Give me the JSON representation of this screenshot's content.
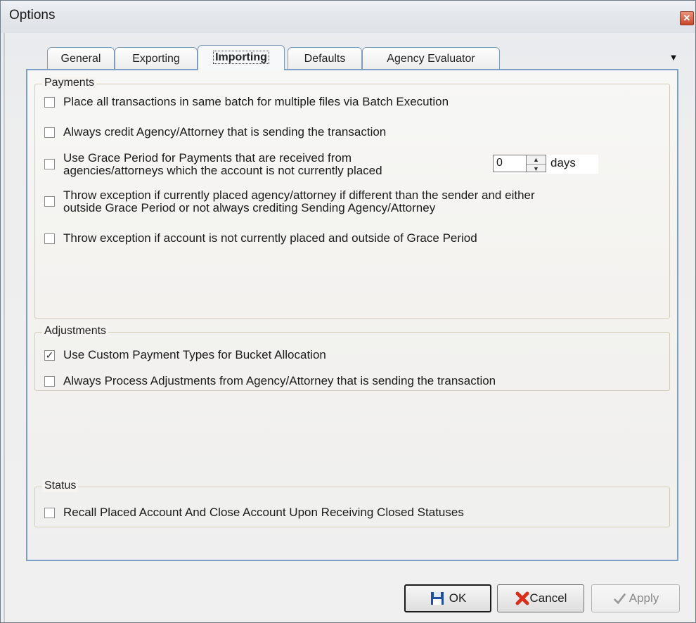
{
  "window": {
    "title": "Options"
  },
  "tabs": [
    {
      "label": "General"
    },
    {
      "label": "Exporting"
    },
    {
      "label": "Importing",
      "active": true
    },
    {
      "label": "Defaults"
    },
    {
      "label": "Agency Evaluator"
    }
  ],
  "payments": {
    "legend": "Payments",
    "options": [
      {
        "label": "Place all transactions in same batch for multiple files via Batch Execution",
        "checked": false
      },
      {
        "label": "Always credit Agency/Attorney that is sending the transaction",
        "checked": false
      },
      {
        "label_line1": "Use Grace Period for Payments that are received from",
        "label_line2": "agencies/attorneys which the account is not currently placed",
        "checked": false
      },
      {
        "label_line1": "Throw exception if currently placed agency/attorney if different than the sender and either",
        "label_line2": "outside Grace Period or not always crediting Sending Agency/Attorney",
        "checked": false
      },
      {
        "label": "Throw exception if account is not currently placed and outside of Grace Period",
        "checked": false
      }
    ],
    "grace_period": {
      "value": "0",
      "unit": "days"
    }
  },
  "adjustments": {
    "legend": "Adjustments",
    "options": [
      {
        "label": "Use Custom Payment Types for Bucket Allocation",
        "checked": true
      },
      {
        "label": "Always Process Adjustments from Agency/Attorney that is sending the transaction",
        "checked": false
      }
    ]
  },
  "status": {
    "legend": "Status",
    "options": [
      {
        "label": "Recall Placed Account And Close Account Upon Receiving Closed Statuses",
        "checked": false
      }
    ]
  },
  "buttons": {
    "ok": "OK",
    "cancel": "Cancel",
    "apply": "Apply"
  },
  "icons": {
    "ok": "save-icon",
    "cancel": "red-x-icon",
    "apply": "checkmark-icon",
    "tab_menu": "dropdown-arrow-icon",
    "close": "close-icon"
  },
  "colors": {
    "panel_border": "#7d9ec9",
    "group_border": "#d2cdb8",
    "cancel_icon": "#d9301c",
    "ok_icon": "#1f4fa3"
  }
}
